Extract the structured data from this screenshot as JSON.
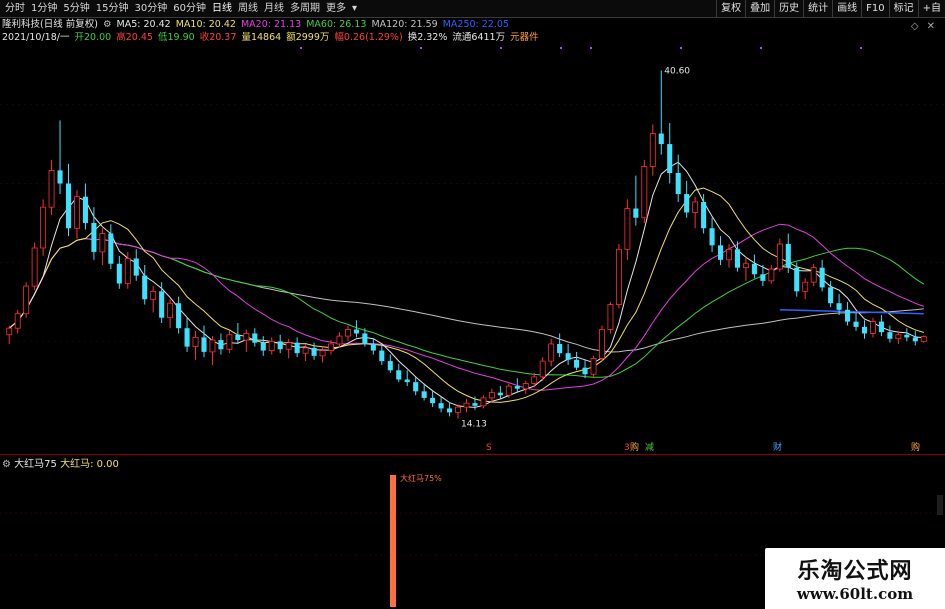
{
  "toolbar": {
    "tabs": [
      "分时",
      "1分钟",
      "5分钟",
      "15分钟",
      "30分钟",
      "60分钟",
      "日线",
      "周线",
      "月线",
      "多周期",
      "更多"
    ],
    "right_buttons": [
      "复权",
      "叠加",
      "历史",
      "统计",
      "画线",
      "F10",
      "标记",
      "+自"
    ]
  },
  "info_row1": {
    "name": "隆利科技(日线 前复权)",
    "ma5": "MA5: 20.42",
    "ma10": "MA10: 20.42",
    "ma20": "MA20: 21.13",
    "ma60": "MA60: 26.13",
    "ma120": "MA120: 21.59",
    "ma250": "MA250: 22.05"
  },
  "info_row2": {
    "date": "2021/10/18/一",
    "open": "开20.00",
    "high": "高20.45",
    "low": "低19.90",
    "close": "收20.37",
    "volume": "量14864",
    "amount": "额2999万",
    "change": "幅0.26(1.29%)",
    "turnover": "换2.32%",
    "float": "流通6411万",
    "sector": "元器件"
  },
  "annotations": {
    "high_price": "40.60",
    "low_price": "14.13",
    "event_s": "S",
    "event_3": "3",
    "event_jian": "减",
    "event_cai": "财",
    "event_gou": "购"
  },
  "indicator": {
    "name": "大红马75",
    "series": "大红马: 0.00",
    "bar_label": "大红马75%"
  },
  "watermark": {
    "title": "乐淘公式网",
    "url": "www.60lt.com"
  },
  "colors": {
    "up": "#ff3030",
    "down": "#40e0ff",
    "ma5": "#e6e6e6",
    "ma10": "#f0e060",
    "ma20": "#e040e0",
    "ma60": "#40d040",
    "ma120": "#c0c0c0",
    "ma250": "#3060ff",
    "indicator_bar": "#ff7040"
  },
  "chart_data": {
    "type": "candlestick",
    "ylim": [
      12.5,
      42
    ],
    "high": 40.6,
    "low": 14.13,
    "candles": [
      [
        20.5,
        21.2,
        19.8,
        21.0
      ],
      [
        21.0,
        22.4,
        20.6,
        22.1
      ],
      [
        22.1,
        24.5,
        21.8,
        24.2
      ],
      [
        24.2,
        27.5,
        23.9,
        27.1
      ],
      [
        27.1,
        30.8,
        26.5,
        30.2
      ],
      [
        30.2,
        33.8,
        29.6,
        33.0
      ],
      [
        33.0,
        36.8,
        31.2,
        32.0
      ],
      [
        32.0,
        33.5,
        28.0,
        28.6
      ],
      [
        28.6,
        31.5,
        27.8,
        31.0
      ],
      [
        31.0,
        32.0,
        28.5,
        29.0
      ],
      [
        29.0,
        30.2,
        26.2,
        26.8
      ],
      [
        26.8,
        28.6,
        25.8,
        28.2
      ],
      [
        28.2,
        28.9,
        25.5,
        25.9
      ],
      [
        25.9,
        26.5,
        24.0,
        24.4
      ],
      [
        24.4,
        26.8,
        24.0,
        26.3
      ],
      [
        26.3,
        27.0,
        24.6,
        25.0
      ],
      [
        25.0,
        25.8,
        22.8,
        23.2
      ],
      [
        23.2,
        24.2,
        22.2,
        23.8
      ],
      [
        23.8,
        24.5,
        21.4,
        21.8
      ],
      [
        21.8,
        23.2,
        21.0,
        22.9
      ],
      [
        22.9,
        23.4,
        20.6,
        21.0
      ],
      [
        21.0,
        21.8,
        19.2,
        19.6
      ],
      [
        19.6,
        20.8,
        18.6,
        20.3
      ],
      [
        20.3,
        21.2,
        18.8,
        19.2
      ],
      [
        19.2,
        20.4,
        18.2,
        20.1
      ],
      [
        20.1,
        20.6,
        19.0,
        19.4
      ],
      [
        19.4,
        20.8,
        19.1,
        20.5
      ],
      [
        20.5,
        21.4,
        19.8,
        20.1
      ],
      [
        20.1,
        20.9,
        19.2,
        20.6
      ],
      [
        20.6,
        21.0,
        19.6,
        19.9
      ],
      [
        19.9,
        20.4,
        18.9,
        19.3
      ],
      [
        19.3,
        20.3,
        19.0,
        20.0
      ],
      [
        20.0,
        20.5,
        19.1,
        19.4
      ],
      [
        19.4,
        20.2,
        18.7,
        19.9
      ],
      [
        19.9,
        20.3,
        18.8,
        19.1
      ],
      [
        19.1,
        19.8,
        18.5,
        19.5
      ],
      [
        19.5,
        19.9,
        18.6,
        18.9
      ],
      [
        18.9,
        19.6,
        18.4,
        19.3
      ],
      [
        19.3,
        20.1,
        19.0,
        19.8
      ],
      [
        19.8,
        20.7,
        19.5,
        20.4
      ],
      [
        20.4,
        21.2,
        20.0,
        20.9
      ],
      [
        20.9,
        21.6,
        20.3,
        20.6
      ],
      [
        20.6,
        21.0,
        19.6,
        19.8
      ],
      [
        19.8,
        20.2,
        19.0,
        19.3
      ],
      [
        19.3,
        19.8,
        18.2,
        18.5
      ],
      [
        18.5,
        19.0,
        17.6,
        17.8
      ],
      [
        17.8,
        18.3,
        16.9,
        17.1
      ],
      [
        17.1,
        17.8,
        16.6,
        16.9
      ],
      [
        16.9,
        17.3,
        15.9,
        16.2
      ],
      [
        16.2,
        16.8,
        15.5,
        15.7
      ],
      [
        15.7,
        16.2,
        15.0,
        15.3
      ],
      [
        15.3,
        15.8,
        14.6,
        14.9
      ],
      [
        14.9,
        15.4,
        14.3,
        14.6
      ],
      [
        14.6,
        15.2,
        14.13,
        15.0
      ],
      [
        15.0,
        15.6,
        14.6,
        15.3
      ],
      [
        15.3,
        15.8,
        14.8,
        15.1
      ],
      [
        15.1,
        15.9,
        14.9,
        15.7
      ],
      [
        15.7,
        16.4,
        15.3,
        16.1
      ],
      [
        16.1,
        16.6,
        15.6,
        15.9
      ],
      [
        15.9,
        16.8,
        15.7,
        16.6
      ],
      [
        16.6,
        17.2,
        16.1,
        16.4
      ],
      [
        16.4,
        17.0,
        16.0,
        16.8
      ],
      [
        16.8,
        17.6,
        16.5,
        17.3
      ],
      [
        17.3,
        18.8,
        17.0,
        18.5
      ],
      [
        18.5,
        20.2,
        18.1,
        19.8
      ],
      [
        19.8,
        20.6,
        18.8,
        19.1
      ],
      [
        19.1,
        19.8,
        18.2,
        18.6
      ],
      [
        18.6,
        19.2,
        17.8,
        18.0
      ],
      [
        18.0,
        18.6,
        17.2,
        17.5
      ],
      [
        17.5,
        18.9,
        17.3,
        18.7
      ],
      [
        18.7,
        21.2,
        18.5,
        20.9
      ],
      [
        20.9,
        23.0,
        20.6,
        22.8
      ],
      [
        22.8,
        27.4,
        22.5,
        27.0
      ],
      [
        27.0,
        30.8,
        26.2,
        30.1
      ],
      [
        30.1,
        32.6,
        28.8,
        29.4
      ],
      [
        29.4,
        33.8,
        29.0,
        33.3
      ],
      [
        33.3,
        36.5,
        32.6,
        35.8
      ],
      [
        35.8,
        40.6,
        34.2,
        35.0
      ],
      [
        35.0,
        36.6,
        32.0,
        32.8
      ],
      [
        32.8,
        34.2,
        30.6,
        31.2
      ],
      [
        31.2,
        32.2,
        29.4,
        29.8
      ],
      [
        29.8,
        31.0,
        28.6,
        30.6
      ],
      [
        30.6,
        31.2,
        28.2,
        28.6
      ],
      [
        28.6,
        29.4,
        26.8,
        27.3
      ],
      [
        27.3,
        28.0,
        25.8,
        26.2
      ],
      [
        26.2,
        27.4,
        25.6,
        27.0
      ],
      [
        27.0,
        27.6,
        25.3,
        25.6
      ],
      [
        25.6,
        26.4,
        24.6,
        25.9
      ],
      [
        25.9,
        26.6,
        24.8,
        25.1
      ],
      [
        25.1,
        25.8,
        24.2,
        24.6
      ],
      [
        24.6,
        25.8,
        24.4,
        25.5
      ],
      [
        25.5,
        27.8,
        25.3,
        27.4
      ],
      [
        27.4,
        28.2,
        25.2,
        25.6
      ],
      [
        25.6,
        26.0,
        23.4,
        23.8
      ],
      [
        23.8,
        24.8,
        23.2,
        24.5
      ],
      [
        24.5,
        25.9,
        24.2,
        25.6
      ],
      [
        25.6,
        26.2,
        23.8,
        24.1
      ],
      [
        24.1,
        24.6,
        22.6,
        22.9
      ],
      [
        22.9,
        23.6,
        22.0,
        22.4
      ],
      [
        22.4,
        23.0,
        21.2,
        21.5
      ],
      [
        21.5,
        22.2,
        20.8,
        21.1
      ],
      [
        21.1,
        21.6,
        20.2,
        20.6
      ],
      [
        20.6,
        21.8,
        20.3,
        21.5
      ],
      [
        21.5,
        22.0,
        20.4,
        20.7
      ],
      [
        20.7,
        21.2,
        19.9,
        20.2
      ],
      [
        20.2,
        20.8,
        19.8,
        20.5
      ],
      [
        20.5,
        21.0,
        20.0,
        20.3
      ],
      [
        20.3,
        20.8,
        19.7,
        20.0
      ],
      [
        20.0,
        20.45,
        19.9,
        20.37
      ]
    ]
  }
}
